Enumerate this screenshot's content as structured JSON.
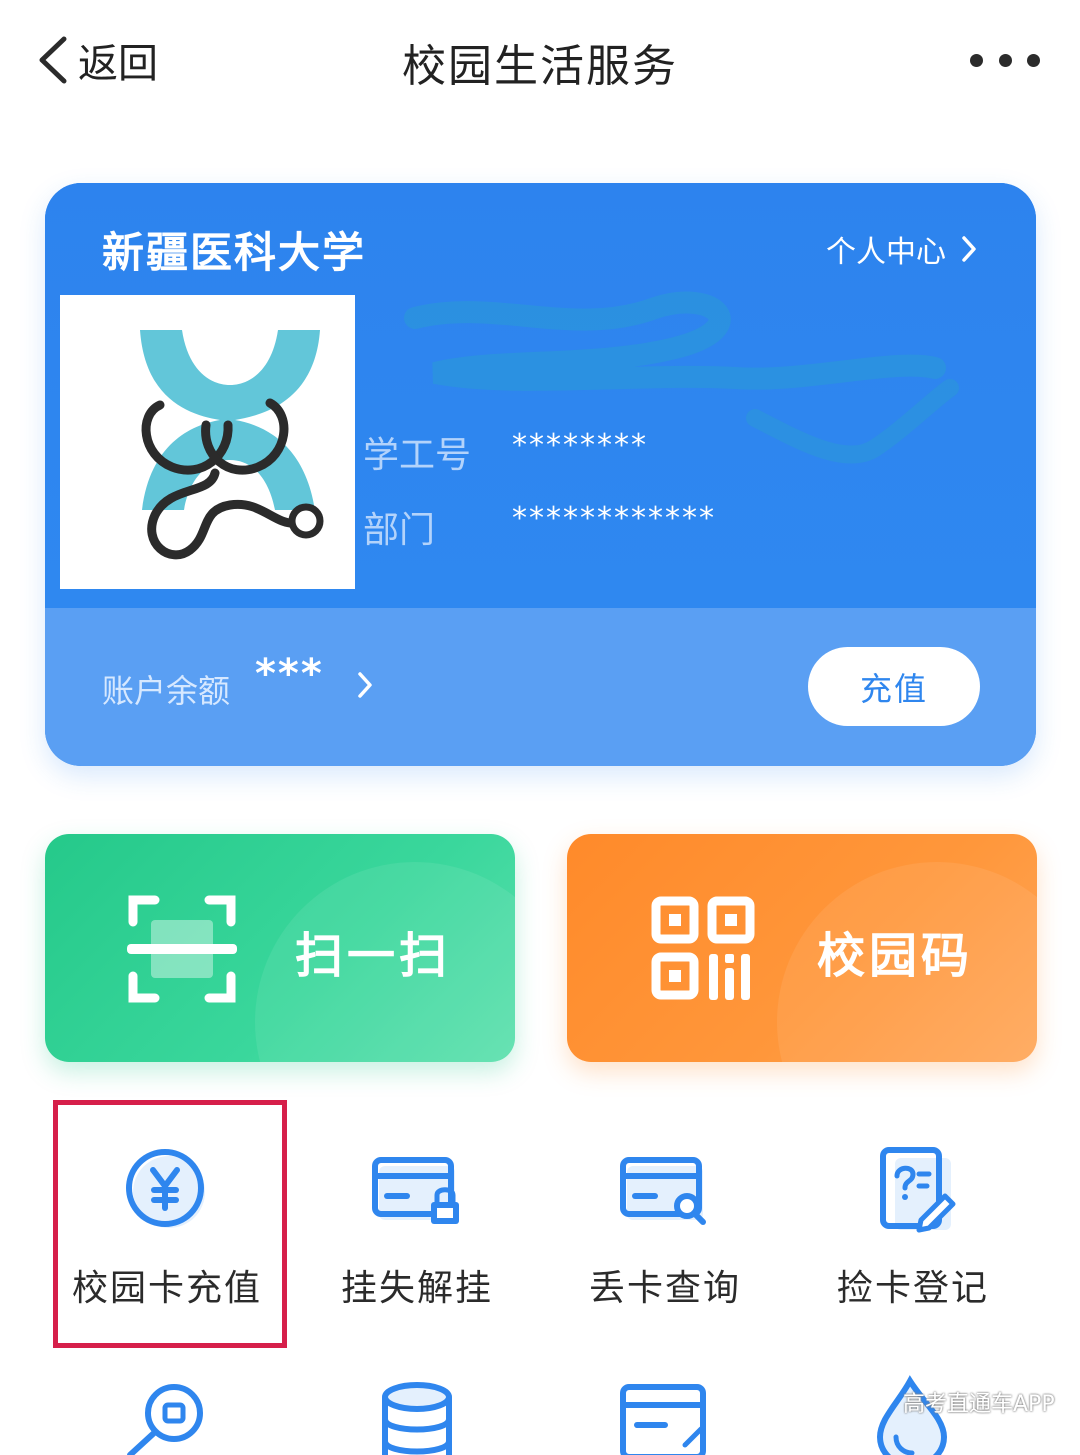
{
  "header": {
    "back_label": "返回",
    "title": "校园生活服务"
  },
  "card": {
    "university": "新疆医科大学",
    "personal_center": "个人中心",
    "student_id_label": "学工号",
    "student_id_value": "********",
    "department_label": "部门",
    "department_value": "************",
    "balance_label": "账户余额",
    "balance_value": "***",
    "recharge_button": "充值"
  },
  "actions": {
    "scan_label": "扫一扫",
    "campus_code_label": "校园码"
  },
  "services": [
    {
      "label": "校园卡充值",
      "icon": "yuan-coin-icon"
    },
    {
      "label": "挂失解挂",
      "icon": "card-lock-icon"
    },
    {
      "label": "丢卡查询",
      "icon": "card-search-icon"
    },
    {
      "label": "捡卡登记",
      "icon": "form-edit-icon"
    }
  ],
  "watermark": "高考直通车APP",
  "colors": {
    "card_blue": "#2f86ee",
    "scan_green": "#25c98a",
    "qr_orange": "#ff8a2a",
    "highlight_red": "#d61f4a"
  }
}
